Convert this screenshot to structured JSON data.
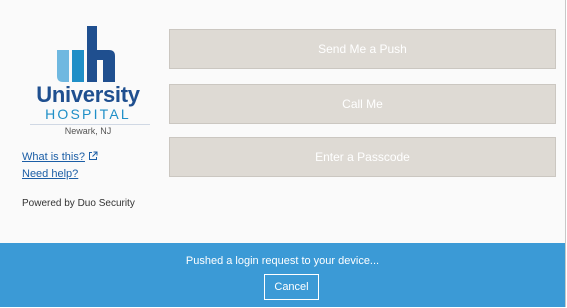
{
  "branding": {
    "org_name": "University",
    "org_sub": "HOSPITAL",
    "location": "Newark, NJ",
    "colors": {
      "navy": "#1f4f8f",
      "blue": "#1f8fc7",
      "light_blue": "#6fb8e0"
    }
  },
  "links": {
    "what_is_this": "What is this?",
    "need_help": "Need help?",
    "external_icon": "external-link-icon"
  },
  "footer": {
    "powered_by": "Powered by Duo Security"
  },
  "auth_options": {
    "push": "Send Me a Push",
    "call": "Call Me",
    "passcode": "Enter a Passcode",
    "button_color": "#dedad4"
  },
  "status": {
    "message": "Pushed a login request to your device...",
    "cancel_label": "Cancel",
    "bar_color": "#3b9ad6"
  }
}
